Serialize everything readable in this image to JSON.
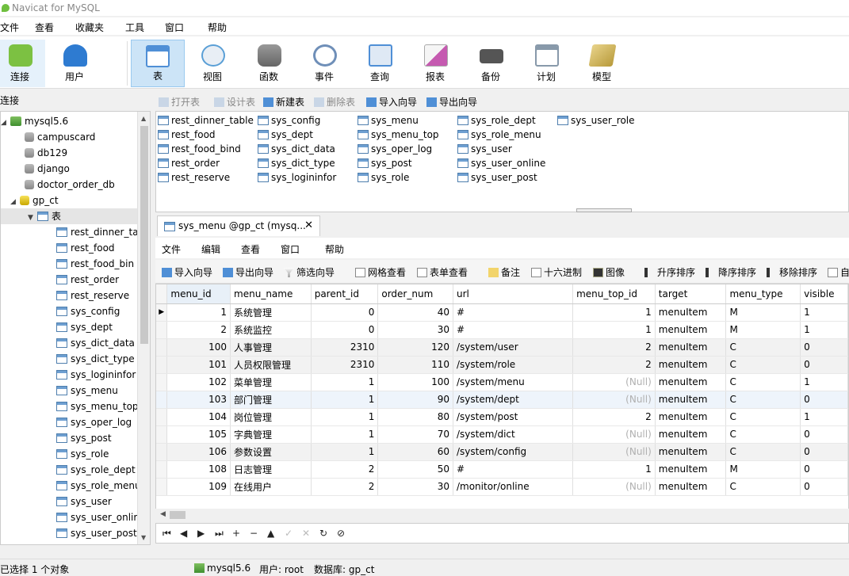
{
  "window": {
    "title": "Navicat for MySQL"
  },
  "menubar": [
    "文件",
    "查看",
    "收藏夹",
    "工具",
    "窗口",
    "帮助"
  ],
  "toolbar": [
    {
      "label": "连接",
      "icon": "plug-icon",
      "color": "#7cc142"
    },
    {
      "label": "用户",
      "icon": "user-icon",
      "color": "#2e7bd1"
    },
    {
      "label": "表",
      "icon": "table-icon",
      "color": "#4f8fd6"
    },
    {
      "label": "视图",
      "icon": "view-icon",
      "color": "#5a9fd6"
    },
    {
      "label": "函数",
      "icon": "function-icon",
      "color": "#e8a33b"
    },
    {
      "label": "事件",
      "icon": "clock-icon",
      "color": "#6f8fb8"
    },
    {
      "label": "查询",
      "icon": "query-icon",
      "color": "#4f8fd6"
    },
    {
      "label": "报表",
      "icon": "report-icon",
      "color": "#c55ab0"
    },
    {
      "label": "备份",
      "icon": "backup-icon",
      "color": "#666666"
    },
    {
      "label": "计划",
      "icon": "calendar-icon",
      "color": "#8899aa"
    },
    {
      "label": "模型",
      "icon": "model-icon",
      "color": "#d4b35a"
    }
  ],
  "left_pane": {
    "header": "连接",
    "server": "mysql5.6",
    "databases": [
      "campuscard",
      "db129",
      "django",
      "doctor_order_db",
      "gp_ct"
    ],
    "tables_node": "表",
    "tables": [
      "rest_dinner_ta",
      "rest_food",
      "rest_food_bin",
      "rest_order",
      "rest_reserve",
      "sys_config",
      "sys_dept",
      "sys_dict_data",
      "sys_dict_type",
      "sys_logininfor",
      "sys_menu",
      "sys_menu_top",
      "sys_oper_log",
      "sys_post",
      "sys_role",
      "sys_role_dept",
      "sys_role_menu",
      "sys_user",
      "sys_user_onlir",
      "sys_user_post"
    ]
  },
  "object_toolbar": {
    "open": "打开表",
    "design": "设计表",
    "new": "新建表",
    "delete": "删除表",
    "import": "导入向导",
    "export": "导出向导"
  },
  "object_tables": [
    "rest_dinner_table",
    "rest_food",
    "rest_food_bind",
    "rest_order",
    "rest_reserve",
    "sys_config",
    "sys_dept",
    "sys_dict_data",
    "sys_dict_type",
    "sys_logininfor",
    "sys_menu",
    "sys_menu_top",
    "sys_oper_log",
    "sys_post",
    "sys_role",
    "sys_role_dept",
    "sys_role_menu",
    "sys_user",
    "sys_user_online",
    "sys_user_post",
    "sys_user_role"
  ],
  "tab": {
    "title": "sys_menu @gp_ct (mysq...",
    "close": "✕"
  },
  "inner_menu": [
    "文件",
    "编辑",
    "查看",
    "窗口",
    "帮助"
  ],
  "inner_toolbar": {
    "import": "导入向导",
    "export": "导出向导",
    "filter": "筛选向导",
    "grid_view": "网格查看",
    "form_view": "表单查看",
    "memo": "备注",
    "hex": "十六进制",
    "image": "图像",
    "sort_asc": "升序排序",
    "sort_desc": "降序排序",
    "remove_sort": "移除排序",
    "more": "自"
  },
  "grid": {
    "columns": [
      "menu_id",
      "menu_name",
      "parent_id",
      "order_num",
      "url",
      "menu_top_id",
      "target",
      "menu_type",
      "visible"
    ],
    "null_text": "(Null)",
    "rows": [
      [
        "1",
        "系统管理",
        "0",
        "40",
        "#",
        "1",
        "menuItem",
        "M",
        "1"
      ],
      [
        "2",
        "系统监控",
        "0",
        "30",
        "#",
        "1",
        "menuItem",
        "M",
        "1"
      ],
      [
        "100",
        "人事管理",
        "2310",
        "120",
        "/system/user",
        "2",
        "menuItem",
        "C",
        "0"
      ],
      [
        "101",
        "人员权限管理",
        "2310",
        "110",
        "/system/role",
        "2",
        "menuItem",
        "C",
        "0"
      ],
      [
        "102",
        "菜单管理",
        "1",
        "100",
        "/system/menu",
        "(Null)",
        "menuItem",
        "C",
        "1"
      ],
      [
        "103",
        "部门管理",
        "1",
        "90",
        "/system/dept",
        "(Null)",
        "menuItem",
        "C",
        "0"
      ],
      [
        "104",
        "岗位管理",
        "1",
        "80",
        "/system/post",
        "2",
        "menuItem",
        "C",
        "1"
      ],
      [
        "105",
        "字典管理",
        "1",
        "70",
        "/system/dict",
        "(Null)",
        "menuItem",
        "C",
        "0"
      ],
      [
        "106",
        "参数设置",
        "1",
        "60",
        "/system/config",
        "(Null)",
        "menuItem",
        "C",
        "0"
      ],
      [
        "108",
        "日志管理",
        "2",
        "50",
        "#",
        "1",
        "menuItem",
        "M",
        "0"
      ],
      [
        "109",
        "在线用户",
        "2",
        "30",
        "/monitor/online",
        "(Null)",
        "menuItem",
        "C",
        "0"
      ]
    ]
  },
  "nav_buttons": [
    "⏮",
    "◀",
    "▶",
    "⏭",
    "+",
    "−",
    "▲",
    "✓",
    "✕",
    "↻",
    "⊘"
  ],
  "statusbar": {
    "selection": "已选择 1 个对象",
    "server": "mysql5.6",
    "user": "用户: root",
    "database": "数据库: gp_ct"
  }
}
